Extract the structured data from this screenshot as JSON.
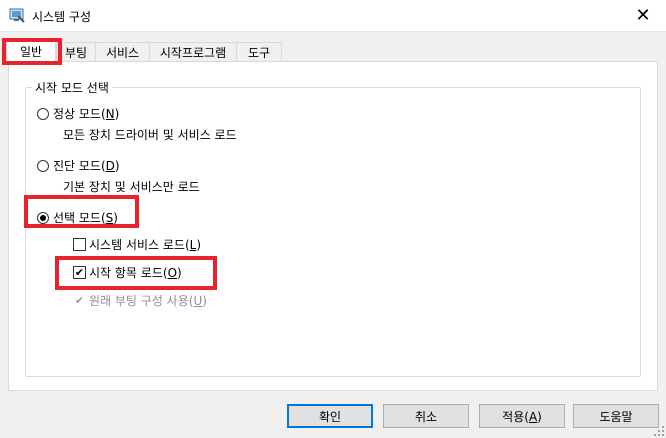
{
  "window": {
    "title": "시스템 구성",
    "close_label": "✕"
  },
  "tabs": [
    {
      "label": "일반"
    },
    {
      "label": "부팅"
    },
    {
      "label": "서비스"
    },
    {
      "label": "시작프로그램"
    },
    {
      "label": "도구"
    }
  ],
  "group": {
    "legend": "시작 모드 선택",
    "normal": {
      "label": "정상 모드",
      "key": "N",
      "desc": "모든 장치 드라이버 및 서비스 로드",
      "checked": false
    },
    "diagnostic": {
      "label": "진단 모드",
      "key": "D",
      "desc": "기본 장치 및 서비스만 로드",
      "checked": false
    },
    "selective": {
      "label": "선택 모드",
      "key": "S",
      "checked": true
    },
    "load_system_services": {
      "label": "시스템 서비스 로드",
      "key": "L",
      "checked": false
    },
    "load_startup_items": {
      "label": "시작 항목 로드",
      "key": "O",
      "checked": true
    },
    "use_original_boot": {
      "label": "원래 부팅 구성 사용",
      "key": "U",
      "checked": true,
      "disabled": true
    }
  },
  "buttons": {
    "ok": "확인",
    "cancel": "취소",
    "apply": {
      "label": "적용",
      "key": "A"
    },
    "help": "도움말"
  },
  "colors": {
    "highlight": "#e8232f",
    "accent": "#0078d7"
  }
}
